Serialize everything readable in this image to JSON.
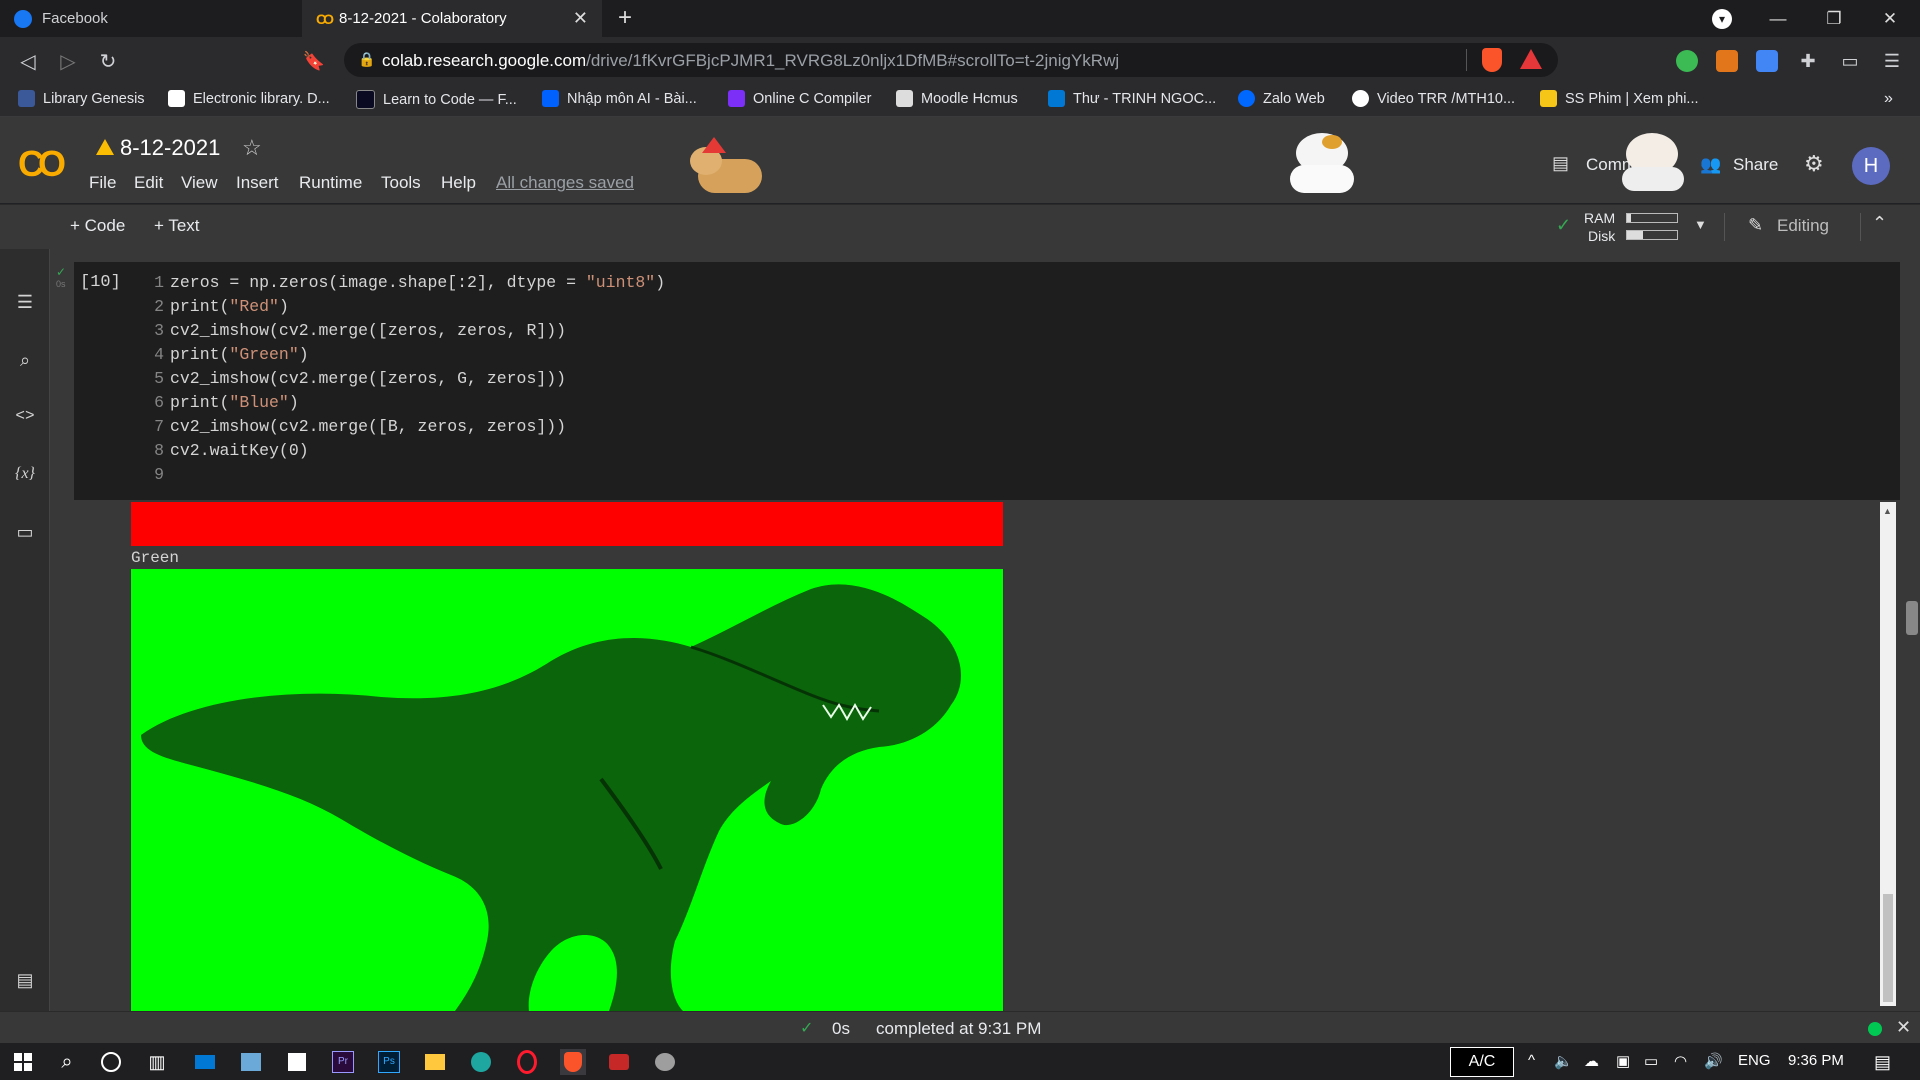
{
  "browser": {
    "tabs": [
      {
        "title": "Facebook",
        "active": false
      },
      {
        "title": "8-12-2021 - Colaboratory",
        "active": true
      }
    ],
    "url_host": "colab.research.google.com",
    "url_path": "/drive/1fKvrGFBjcPJMR1_RVRG8Lz0nljx1DfMB#scrollTo=t-2jnigYkRwj",
    "bookmarks": [
      "Library Genesis",
      "Electronic library. D...",
      "Learn to Code — F...",
      "Nhập môn AI - Bài...",
      "Online C Compiler",
      "Moodle Hcmus",
      "Thư - TRINH NGOC...",
      "Zalo Web",
      "Video TRR /MTH10...",
      "SS Phim | Xem phi..."
    ],
    "more_bookmarks": "»"
  },
  "colab": {
    "logo": "CO",
    "title": "8-12-2021",
    "menu": [
      "File",
      "Edit",
      "View",
      "Insert",
      "Runtime",
      "Tools",
      "Help"
    ],
    "saved_status": "All changes saved",
    "comment_label": "Comment",
    "share_label": "Share",
    "avatar_letter": "H",
    "add_code": "Code",
    "add_text": "Text",
    "ram_label": "RAM",
    "disk_label": "Disk",
    "editing_label": "Editing"
  },
  "cell": {
    "exec_count": "[10]",
    "lines": [
      {
        "n": "1",
        "code": "zeros = np.zeros(image.shape[:2], dtype = \"uint8\")"
      },
      {
        "n": "2",
        "code": "print(\"Red\")"
      },
      {
        "n": "3",
        "code": "cv2_imshow(cv2.merge([zeros, zeros, R]))"
      },
      {
        "n": "4",
        "code": "print(\"Green\")"
      },
      {
        "n": "5",
        "code": "cv2_imshow(cv2.merge([zeros, G, zeros]))"
      },
      {
        "n": "6",
        "code": "print(\"Blue\")"
      },
      {
        "n": "7",
        "code": "cv2_imshow(cv2.merge([B, zeros, zeros]))"
      },
      {
        "n": "8",
        "code": "cv2.waitKey(0)"
      },
      {
        "n": "9",
        "code": ""
      }
    ],
    "output_label": "Green"
  },
  "statusbar": {
    "duration": "0s",
    "completed": "completed at 9:31 PM"
  },
  "taskbar": {
    "ac_label": "A/C",
    "lang": "ENG",
    "time": "9:36 PM"
  },
  "colors": {
    "colab_orange": "#f9ab00",
    "red_channel": "#ff0000",
    "green_channel": "#00ff00",
    "avatar": "#5c6bc0"
  }
}
